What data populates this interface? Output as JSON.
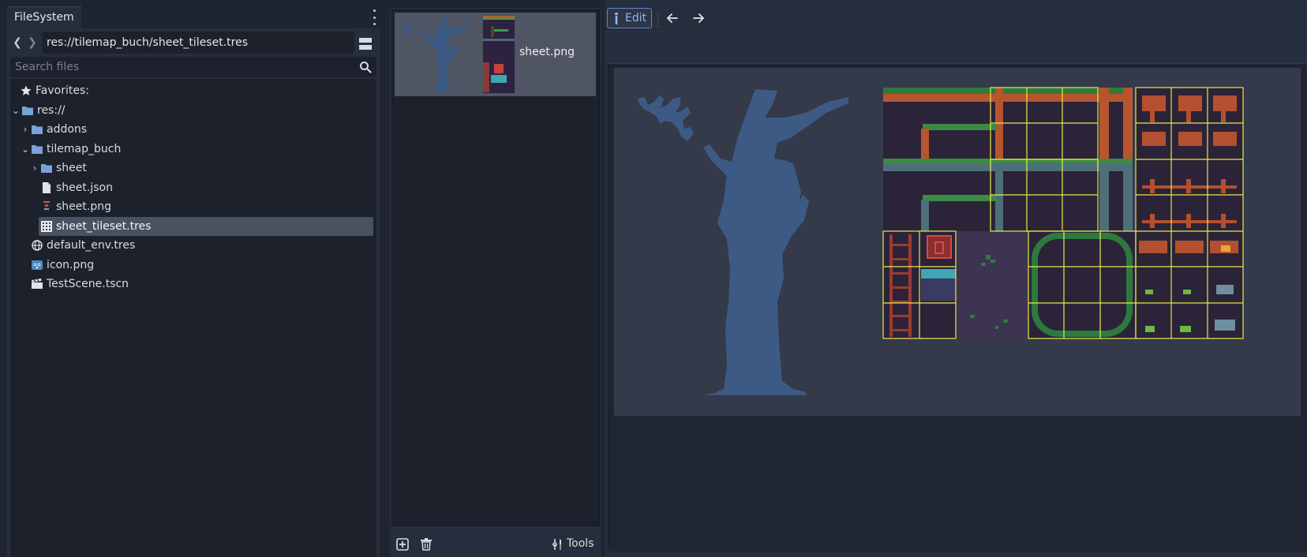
{
  "filesystem": {
    "tab_label": "FileSystem",
    "path": "res://tilemap_buch/sheet_tileset.tres",
    "search_placeholder": "Search files",
    "tree": {
      "favorites": "Favorites:",
      "root": "res://",
      "addons": "addons",
      "tilemap_buch": "tilemap_buch",
      "sheet": "sheet",
      "sheet_json": "sheet.json",
      "sheet_png": "sheet.png",
      "sheet_tileset": "sheet_tileset.tres",
      "default_env": "default_env.tres",
      "icon_png": "icon.png",
      "test_scene": "TestScene.tscn"
    }
  },
  "file_list": {
    "item_name": "sheet.png",
    "tools_label": "Tools"
  },
  "editor": {
    "edit_label": "Edit"
  },
  "colors": {
    "accent": "#5f86c6",
    "selection": "#4a5160",
    "grid_highlight": "#e8e84a",
    "tree_silhouette": "#3d5a85"
  }
}
